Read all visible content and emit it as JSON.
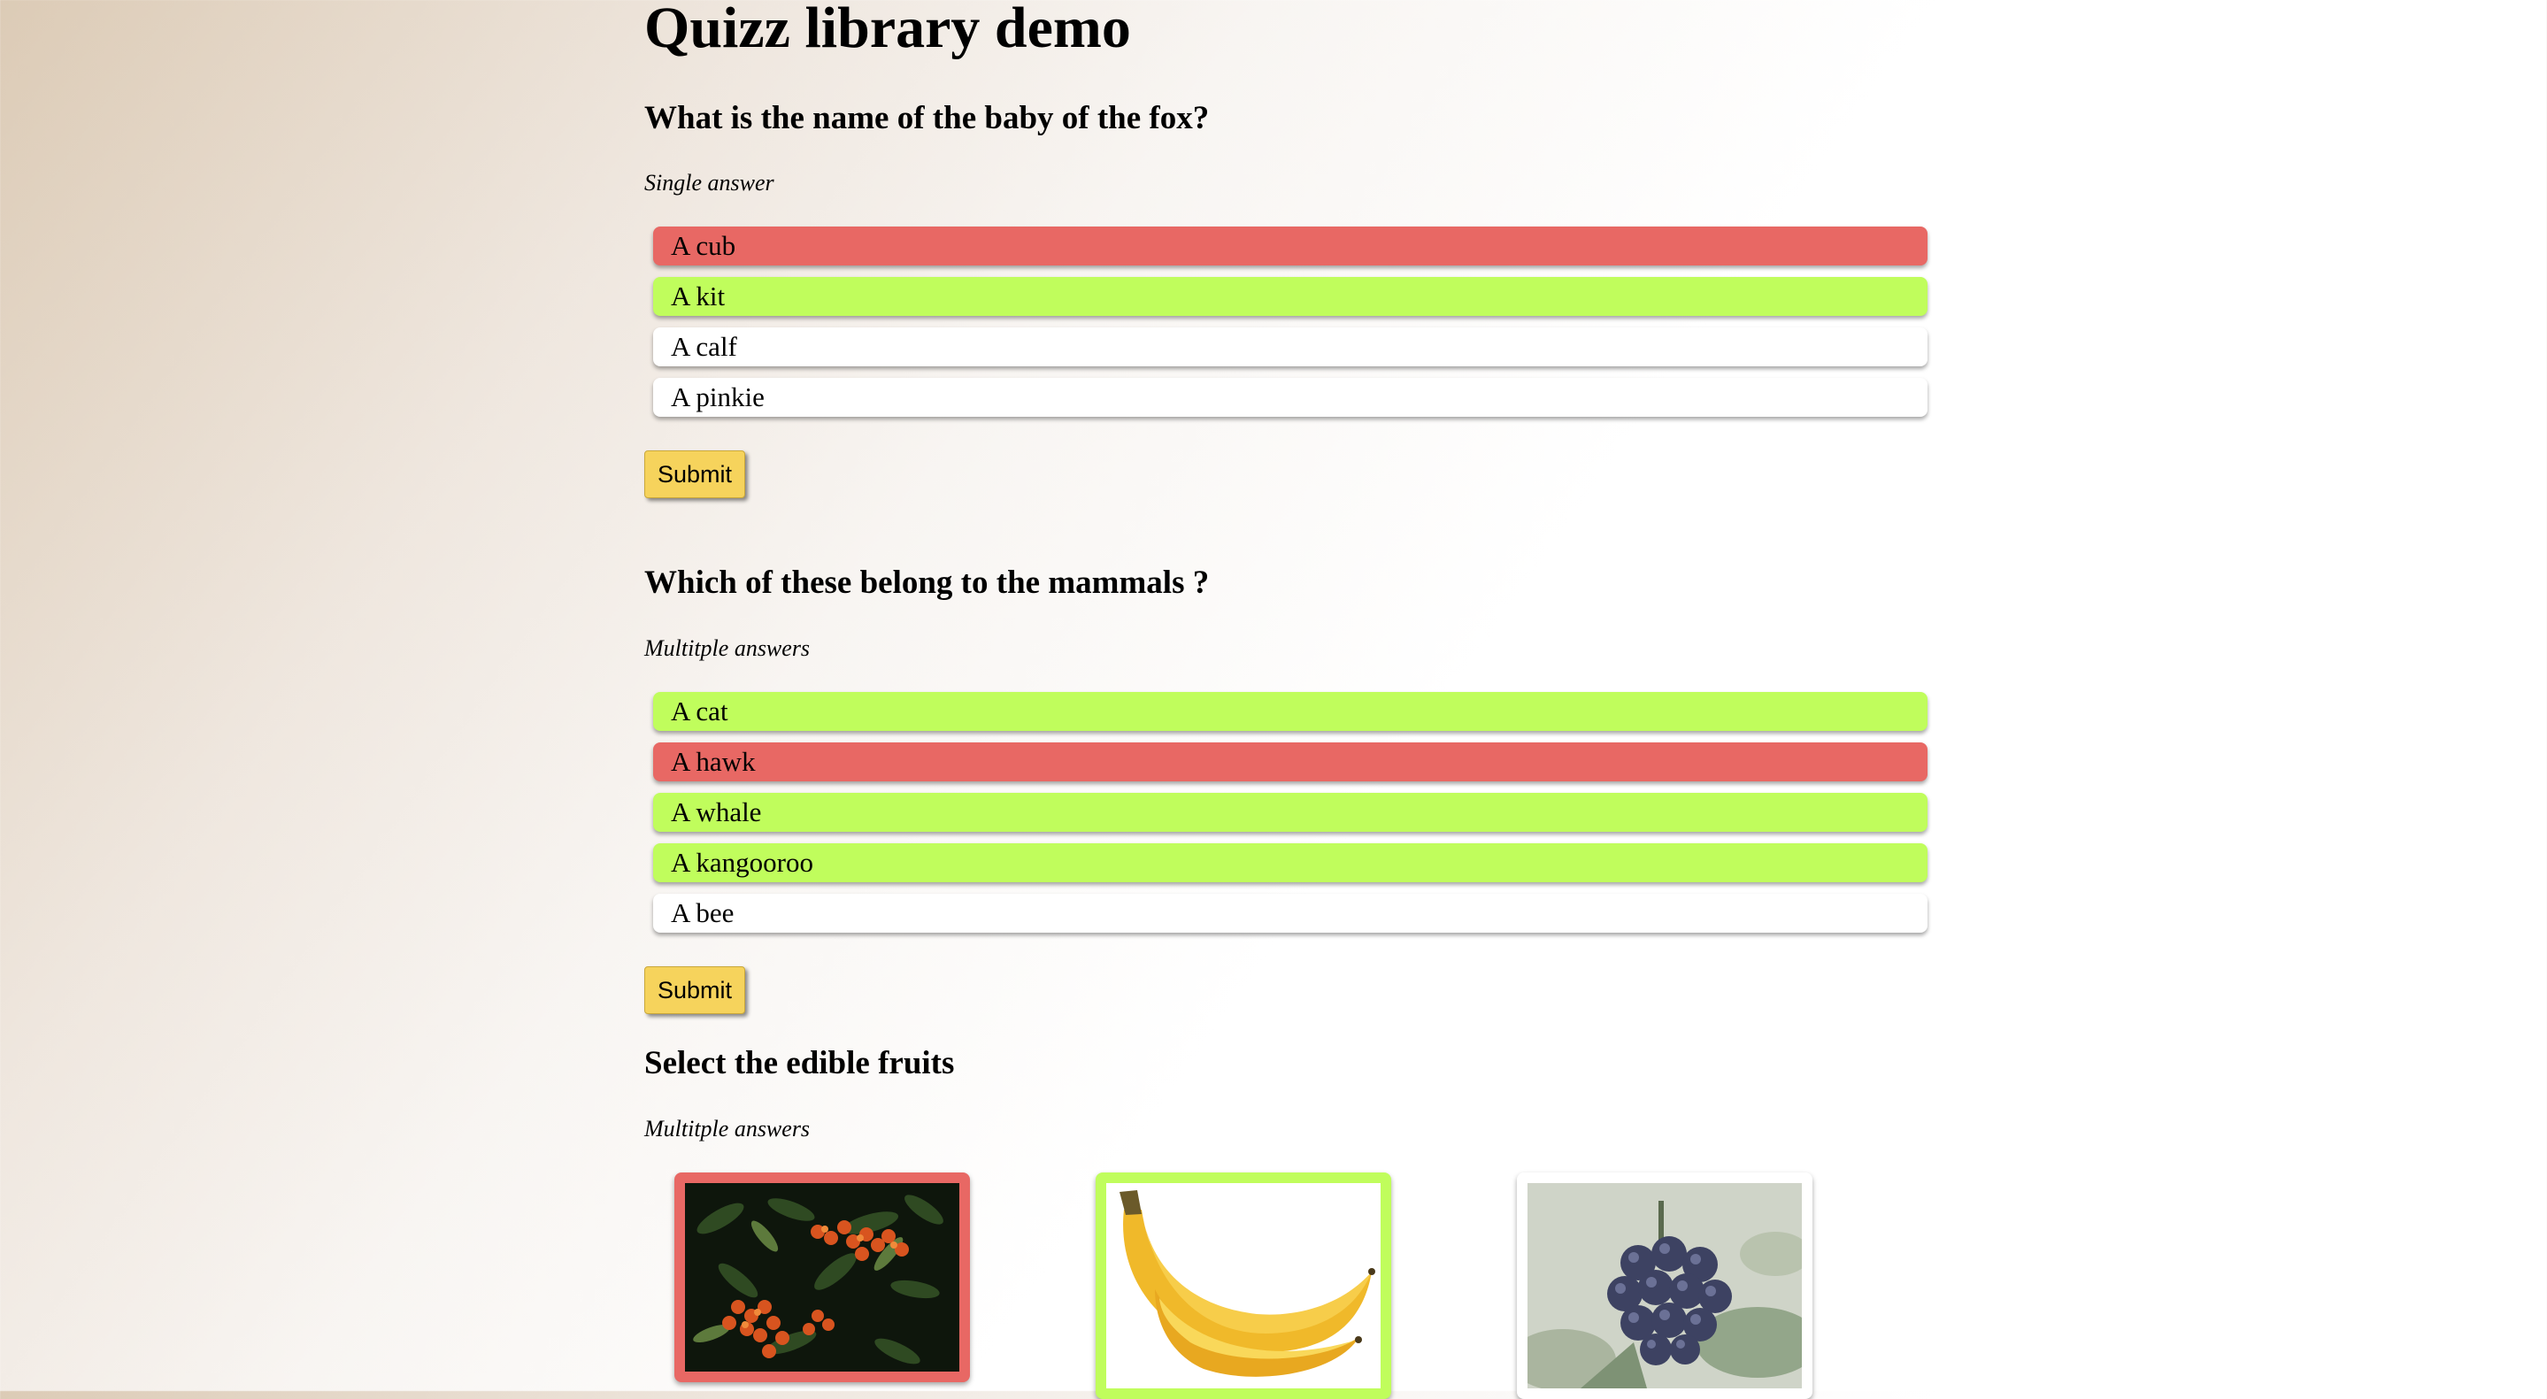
{
  "page": {
    "title": "Quizz library demo"
  },
  "quiz1": {
    "question": "What is the name of the baby of the fox?",
    "mode": "Single answer",
    "options": [
      {
        "label": "A cub",
        "state": "wrong"
      },
      {
        "label": "A kit",
        "state": "correct"
      },
      {
        "label": "A calf",
        "state": "neutral"
      },
      {
        "label": "A pinkie",
        "state": "neutral"
      }
    ],
    "submit_label": "Submit"
  },
  "quiz2": {
    "question": "Which of these belong to the mammals ?",
    "mode": "Multitple answers",
    "options": [
      {
        "label": "A cat",
        "state": "correct"
      },
      {
        "label": "A hawk",
        "state": "wrong"
      },
      {
        "label": "A whale",
        "state": "correct"
      },
      {
        "label": "A kangooroo",
        "state": "correct"
      },
      {
        "label": "A bee",
        "state": "neutral"
      }
    ],
    "submit_label": "Submit"
  },
  "quiz3": {
    "question": "Select the edible fruits",
    "mode": "Multitple answers",
    "images": [
      {
        "subject": "orange-berries-image",
        "state": "wrong"
      },
      {
        "subject": "bananas-image",
        "state": "correct"
      },
      {
        "subject": "dark-berries-image",
        "state": "neutral"
      }
    ]
  },
  "colors": {
    "wrong": "#e86864",
    "correct": "#c0fd5c",
    "neutral": "#ffffff",
    "submit": "#f6d35c"
  }
}
